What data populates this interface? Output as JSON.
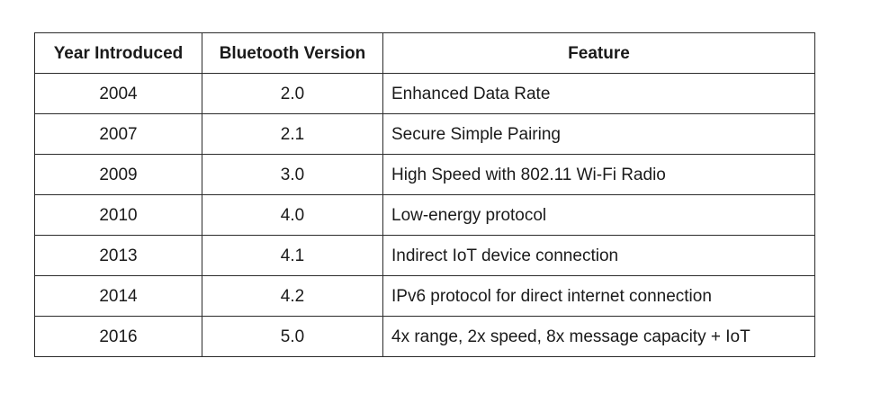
{
  "table": {
    "headers": {
      "year": "Year Introduced",
      "version": "Bluetooth Version",
      "feature": "Feature"
    },
    "rows": [
      {
        "year": "2004",
        "version": "2.0",
        "feature": "Enhanced Data Rate"
      },
      {
        "year": "2007",
        "version": "2.1",
        "feature": "Secure Simple Pairing"
      },
      {
        "year": "2009",
        "version": "3.0",
        "feature": "High Speed with 802.11 Wi-Fi Radio"
      },
      {
        "year": "2010",
        "version": "4.0",
        "feature": "Low-energy protocol"
      },
      {
        "year": "2013",
        "version": "4.1",
        "feature": "Indirect IoT device connection"
      },
      {
        "year": "2014",
        "version": "4.2",
        "feature": "IPv6 protocol for direct internet connection"
      },
      {
        "year": "2016",
        "version": "5.0",
        "feature": "4x range, 2x speed, 8x message capacity + IoT"
      }
    ]
  }
}
